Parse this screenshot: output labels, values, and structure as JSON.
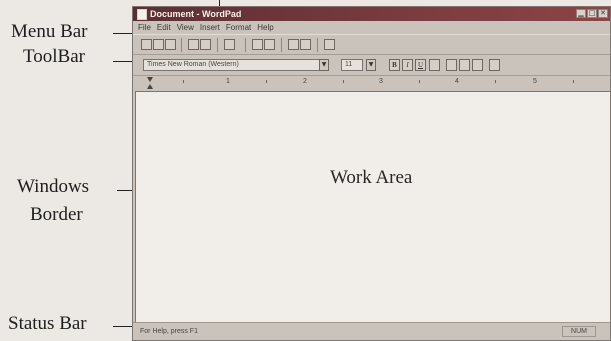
{
  "callouts": {
    "menu_bar": "Menu Bar",
    "toolbar": "ToolBar",
    "windows_border_line1": "Windows",
    "windows_border_line2": "Border",
    "status_bar": "Status Bar"
  },
  "window": {
    "title": "Document - WordPad",
    "menu": [
      "File",
      "Edit",
      "View",
      "Insert",
      "Format",
      "Help"
    ],
    "font_name": "Times New Roman (Western)",
    "font_size": "11",
    "format_buttons": [
      "B",
      "I",
      "U"
    ],
    "ruler_numbers": [
      "1",
      "2",
      "3",
      "4",
      "5"
    ],
    "work_area_label": "Work Area",
    "status_text": "For Help, press F1",
    "status_indicator": "NUM"
  },
  "colors": {
    "title_bar": "#6a3338",
    "background": "#ece8e4",
    "work_area": "#f1ede9"
  }
}
